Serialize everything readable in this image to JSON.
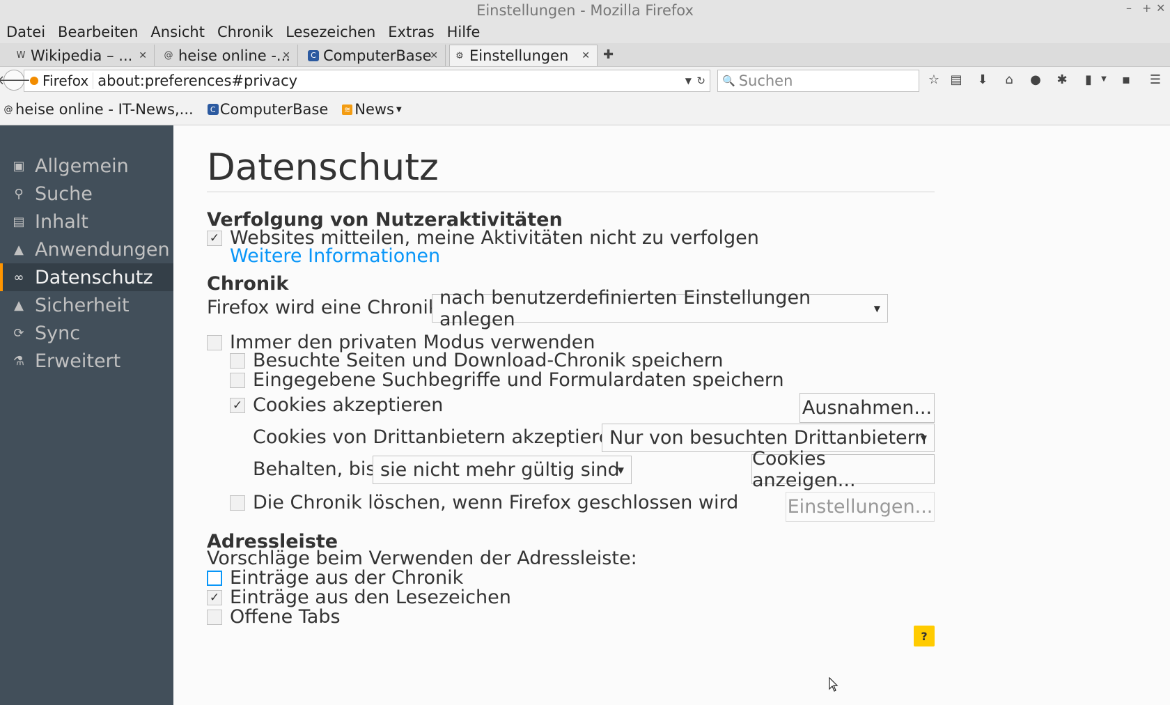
{
  "window": {
    "title": "Einstellungen - Mozilla Firefox",
    "controls": [
      "–",
      "+",
      "✕"
    ]
  },
  "menu": [
    "Datei",
    "Bearbeiten",
    "Ansicht",
    "Chronik",
    "Lesezeichen",
    "Extras",
    "Hilfe"
  ],
  "tabs": [
    {
      "label": "Wikipedia – ...",
      "favicon": "W"
    },
    {
      "label": "heise online -...",
      "favicon": "@"
    },
    {
      "label": "ComputerBase",
      "favicon": "C"
    },
    {
      "label": "Einstellungen",
      "favicon": "⚙"
    }
  ],
  "nav": {
    "identity": "Firefox",
    "url": "about:preferences#privacy",
    "search_placeholder": "Suchen"
  },
  "bookmarks": [
    {
      "label": "heise online - IT-News,...",
      "icon": "at-icon"
    },
    {
      "label": "ComputerBase",
      "icon": "computerbase-icon"
    },
    {
      "label": "News",
      "icon": "feed-icon"
    }
  ],
  "sidebar": {
    "items": [
      {
        "label": "Allgemein",
        "icon": "general-icon"
      },
      {
        "label": "Suche",
        "icon": "search-icon"
      },
      {
        "label": "Inhalt",
        "icon": "content-icon"
      },
      {
        "label": "Anwendungen",
        "icon": "applications-icon"
      },
      {
        "label": "Datenschutz",
        "icon": "privacy-mask-icon"
      },
      {
        "label": "Sicherheit",
        "icon": "security-icon"
      },
      {
        "label": "Sync",
        "icon": "sync-icon"
      },
      {
        "label": "Erweitert",
        "icon": "advanced-icon"
      }
    ],
    "selected": "Datenschutz"
  },
  "page": {
    "title": "Datenschutz",
    "tracking": {
      "heading": "Verfolgung von Nutzeraktivitäten",
      "dnt_label": "Websites mitteilen, meine Aktivitäten nicht zu verfolgen",
      "dnt_checked": true,
      "more_info": "Weitere Informationen"
    },
    "history": {
      "heading": "Chronik",
      "mode_label": "Firefox wird eine Chronik:",
      "mode_value": "nach benutzerdefinierten Einstellungen anlegen",
      "private_label": "Immer den privaten Modus verwenden",
      "visited_label": "Besuchte Seiten und Download-Chronik speichern",
      "forms_label": "Eingegebene Suchbegriffe und Formulardaten speichern",
      "cookies_label": "Cookies akzeptieren",
      "exceptions_button": "Ausnahmen...",
      "third_party_label": "Cookies von Drittanbietern akzeptieren:",
      "third_party_value": "Nur von besuchten Drittanbietern",
      "keep_label": "Behalten, bis:",
      "keep_value": "sie nicht mehr gültig sind",
      "show_cookies_button": "Cookies anzeigen...",
      "clear_label": "Die Chronik löschen, wenn Firefox geschlossen wird",
      "settings_button": "Einstellungen..."
    },
    "urlbar": {
      "heading": "Adressleiste",
      "suggest_label": "Vorschläge beim Verwenden der Adressleiste:",
      "history_label": "Einträge aus der Chronik",
      "bookmarks_label": "Einträge aus den Lesezeichen",
      "tabs_label": "Offene Tabs"
    },
    "help": "?"
  },
  "colors": {
    "sidebar": "#424f5a",
    "accent": "#ff9500",
    "link": "#0996f8",
    "help": "#ffcb00"
  }
}
